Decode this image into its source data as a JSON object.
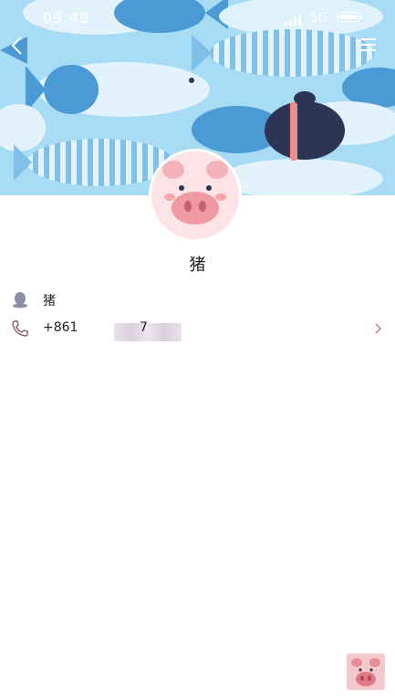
{
  "status_bar": {
    "time": "09:49",
    "network": "5G"
  },
  "profile": {
    "name": "猪"
  },
  "info": [
    {
      "text": "猪",
      "icon": "qq-penguin-icon"
    },
    {
      "text": "+861",
      "tail": "7",
      "icon": "phone-icon"
    }
  ],
  "colors": {
    "sky": "#a8dcf4",
    "fish_dark": "#4b9ad6",
    "fish_stripe": "#7fbfe8",
    "fish_light": "#dff2fc",
    "penguin": "#2d3554",
    "pink": "#f2b4b8",
    "chevron": "#c07a86"
  }
}
